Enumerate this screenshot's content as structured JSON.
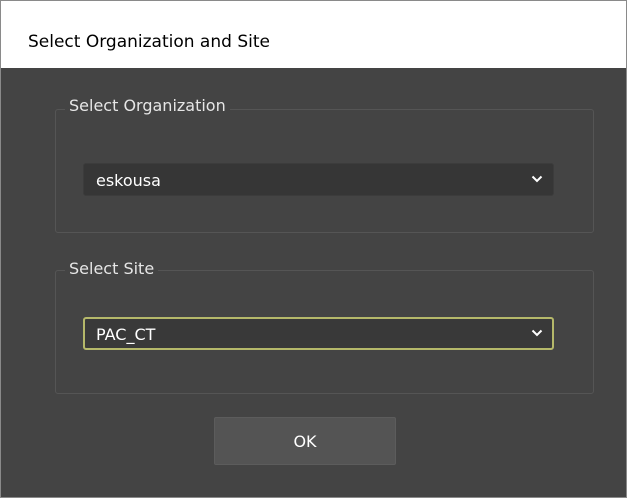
{
  "window": {
    "title": "Select Organization and Site"
  },
  "organization": {
    "group_label": "Select Organization",
    "selected_value": "eskousa",
    "dropdown_icon": "chevron-down-icon"
  },
  "site": {
    "group_label": "Select Site",
    "selected_value": "PAC_CT",
    "dropdown_icon": "chevron-down-icon",
    "focused": true,
    "focus_color": "#b5b86a"
  },
  "actions": {
    "ok_label": "OK"
  },
  "colors": {
    "dialog_background": "#444444",
    "titlebar_background": "#ffffff",
    "text": "#ffffff"
  }
}
